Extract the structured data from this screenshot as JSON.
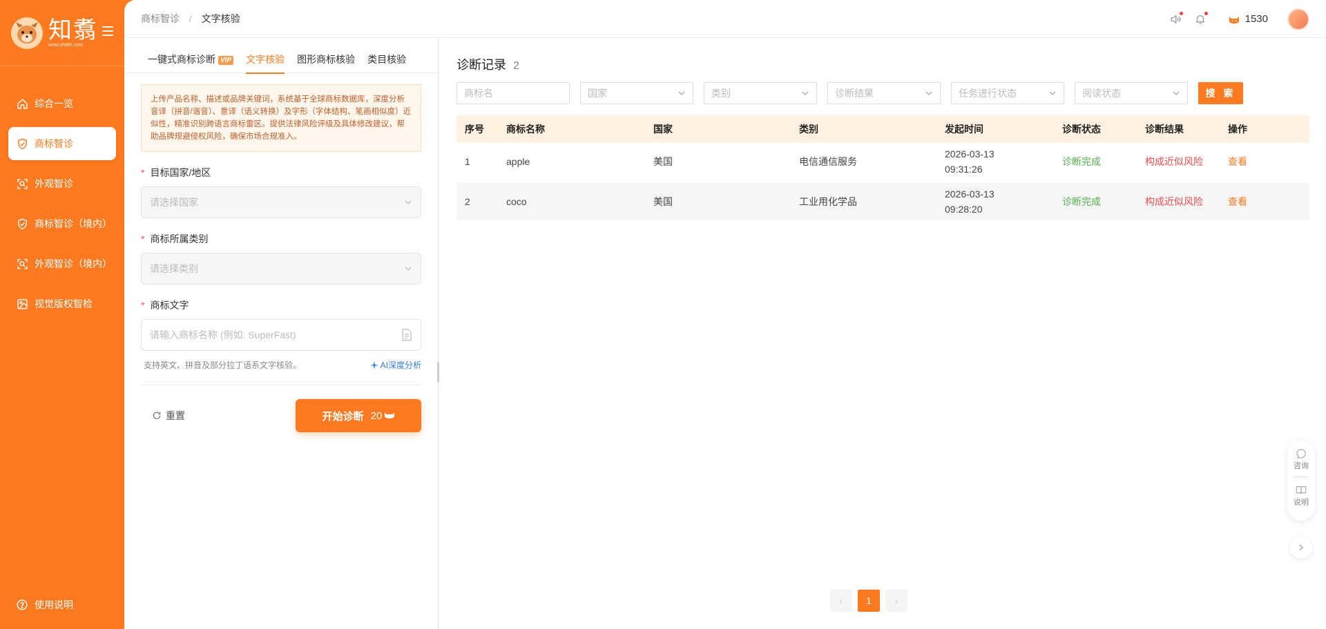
{
  "sidebar": {
    "logo_text": "知翥",
    "logo_url": "www.zhilith.com",
    "items": [
      {
        "label": "综合一览"
      },
      {
        "label": "商标智诊"
      },
      {
        "label": "外观智诊"
      },
      {
        "label": "商标智诊（境内）"
      },
      {
        "label": "外观智诊（境内）"
      },
      {
        "label": "视觉版权智检"
      }
    ],
    "help_label": "使用说明",
    "active_index": 1
  },
  "topbar": {
    "breadcrumb": [
      "商标智诊",
      "文字核验"
    ],
    "coins": "1530",
    "icons": [
      "speaker-icon",
      "bell-icon",
      "coin-cat-icon",
      "avatar"
    ]
  },
  "form": {
    "tabs": [
      {
        "label": "一键式商标诊断",
        "badge": "VIP"
      },
      {
        "label": "文字核验"
      },
      {
        "label": "图形商标核验"
      },
      {
        "label": "类目核验"
      }
    ],
    "active_tab": 1,
    "notice": "上传产品名称、描述或品牌关键词，系统基于全球商标数据库，深度分析音译（拼音/谐音）、意译（语义转换）及字形（字体结构、笔画相似度）近似性，精准识别跨语言商标雷区。提供法律风险评级及具体修改建议，帮助品牌规避侵权风险，确保市场合规准入。",
    "country_label": "目标国家/地区",
    "country_placeholder": "请选择国家",
    "category_label": "商标所属类别",
    "category_placeholder": "请选择类别",
    "text_label": "商标文字",
    "text_placeholder": "请输入商标名称 (例如: SuperFast)",
    "text_value": "",
    "hint": "支持英文、拼音及部分拉丁语系文字核验。",
    "ai_link": "AI深度分析",
    "reset_label": "重置",
    "start_label": "开始诊断",
    "start_cost": "20"
  },
  "records": {
    "title": "诊断记录",
    "count": "2",
    "filters": {
      "name_placeholder": "商标名",
      "selects": [
        "国家",
        "类别",
        "诊断结果",
        "任务进行状态",
        "阅读状态"
      ],
      "search_label": "搜 索"
    },
    "columns": [
      "序号",
      "商标名称",
      "国家",
      "类别",
      "发起时间",
      "诊断状态",
      "诊断结果",
      "操作"
    ],
    "rows": [
      {
        "no": "1",
        "name": "apple",
        "country": "美国",
        "category": "电信通信服务",
        "date": "2026-03-13",
        "time": "09:31:26",
        "status": "诊断完成",
        "result": "构成近似风险",
        "action": "查看"
      },
      {
        "no": "2",
        "name": "coco",
        "country": "美国",
        "category": "工业用化学品",
        "date": "2026-03-13",
        "time": "09:28:20",
        "status": "诊断完成",
        "result": "构成近似风险",
        "action": "查看"
      }
    ],
    "pagination": {
      "prev": "‹",
      "current": "1",
      "next": "›"
    }
  },
  "floating": {
    "consult_label": "咨询",
    "guide_label": "说明"
  },
  "colors": {
    "brand": "#ff7a1f",
    "success": "#52b04a",
    "danger": "#ee4d4d"
  }
}
